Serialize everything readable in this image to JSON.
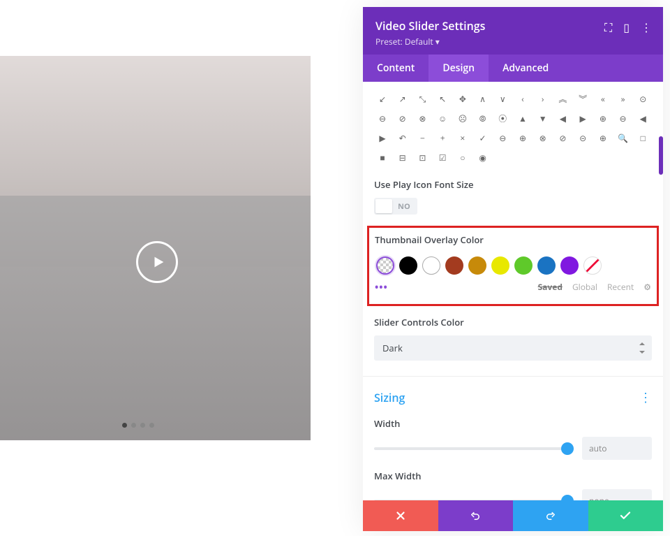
{
  "panel": {
    "title": "Video Slider Settings",
    "preset": "Preset: Default ▾",
    "tabs": {
      "content": "Content",
      "design": "Design",
      "advanced": "Advanced"
    }
  },
  "sections": {
    "usePlayIcon": {
      "label": "Use Play Icon Font Size",
      "toggle": "NO"
    },
    "thumbnailOverlay": {
      "label": "Thumbnail Overlay Color",
      "colors": {
        "transparent": "transparent",
        "black": "#000000",
        "white": "#ffffff",
        "darkred": "#a33b1f",
        "orange": "#c78a0a",
        "yellow": "#e8e800",
        "green": "#5fc92a",
        "blue": "#1a73c2",
        "purple": "#8018e0"
      },
      "tabs": {
        "saved": "Saved",
        "global": "Global",
        "recent": "Recent"
      }
    },
    "sliderControls": {
      "label": "Slider Controls Color",
      "value": "Dark"
    },
    "sizing": {
      "title": "Sizing",
      "width": {
        "label": "Width",
        "value": "auto"
      },
      "maxWidth": {
        "label": "Max Width",
        "value": "none"
      }
    }
  },
  "icons": [
    "↙",
    "↗",
    "⤡",
    "↖",
    "✥",
    "∧",
    "∨",
    "‹",
    "›",
    "︽",
    "︾",
    "«",
    "»",
    "⊙",
    "⊖",
    "⊘",
    "⊗",
    "☺",
    "☹",
    "⦾",
    "⦿",
    "▲",
    "▼",
    "◀",
    "▶",
    "⊕",
    "⊖",
    "◀",
    "▶",
    "↶",
    "−",
    "+",
    "×",
    "✓",
    "⊖",
    "⊕",
    "⊗",
    "⊘",
    "⊝",
    "⊕",
    "🔍",
    "□",
    "■",
    "⊟",
    "⊡",
    "☑",
    "○",
    "◉"
  ]
}
